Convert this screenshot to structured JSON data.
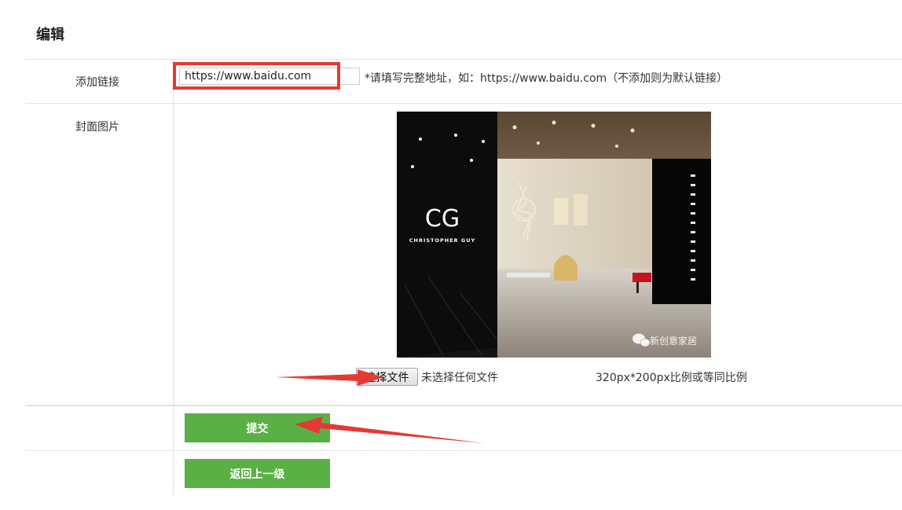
{
  "page": {
    "title": "编辑"
  },
  "link_row": {
    "label": "添加链接",
    "input_value": "https://www.baidu.com",
    "hint": "*请填写完整地址，如：https://www.baidu.com（不添加则为默认链接）"
  },
  "cover_row": {
    "label": "封面图片",
    "image": {
      "brand_mark": "CG",
      "brand_name": "CHRISTOPHER GUY",
      "watermark": "新创意家居"
    },
    "file_button": "选择文件",
    "file_status": "未选择任何文件",
    "size_note": "320px*200px比例或等同比例"
  },
  "actions": {
    "submit": "提交",
    "back": "返回上一级"
  },
  "colors": {
    "accent_green": "#5ab045",
    "highlight_red": "#e53935"
  }
}
